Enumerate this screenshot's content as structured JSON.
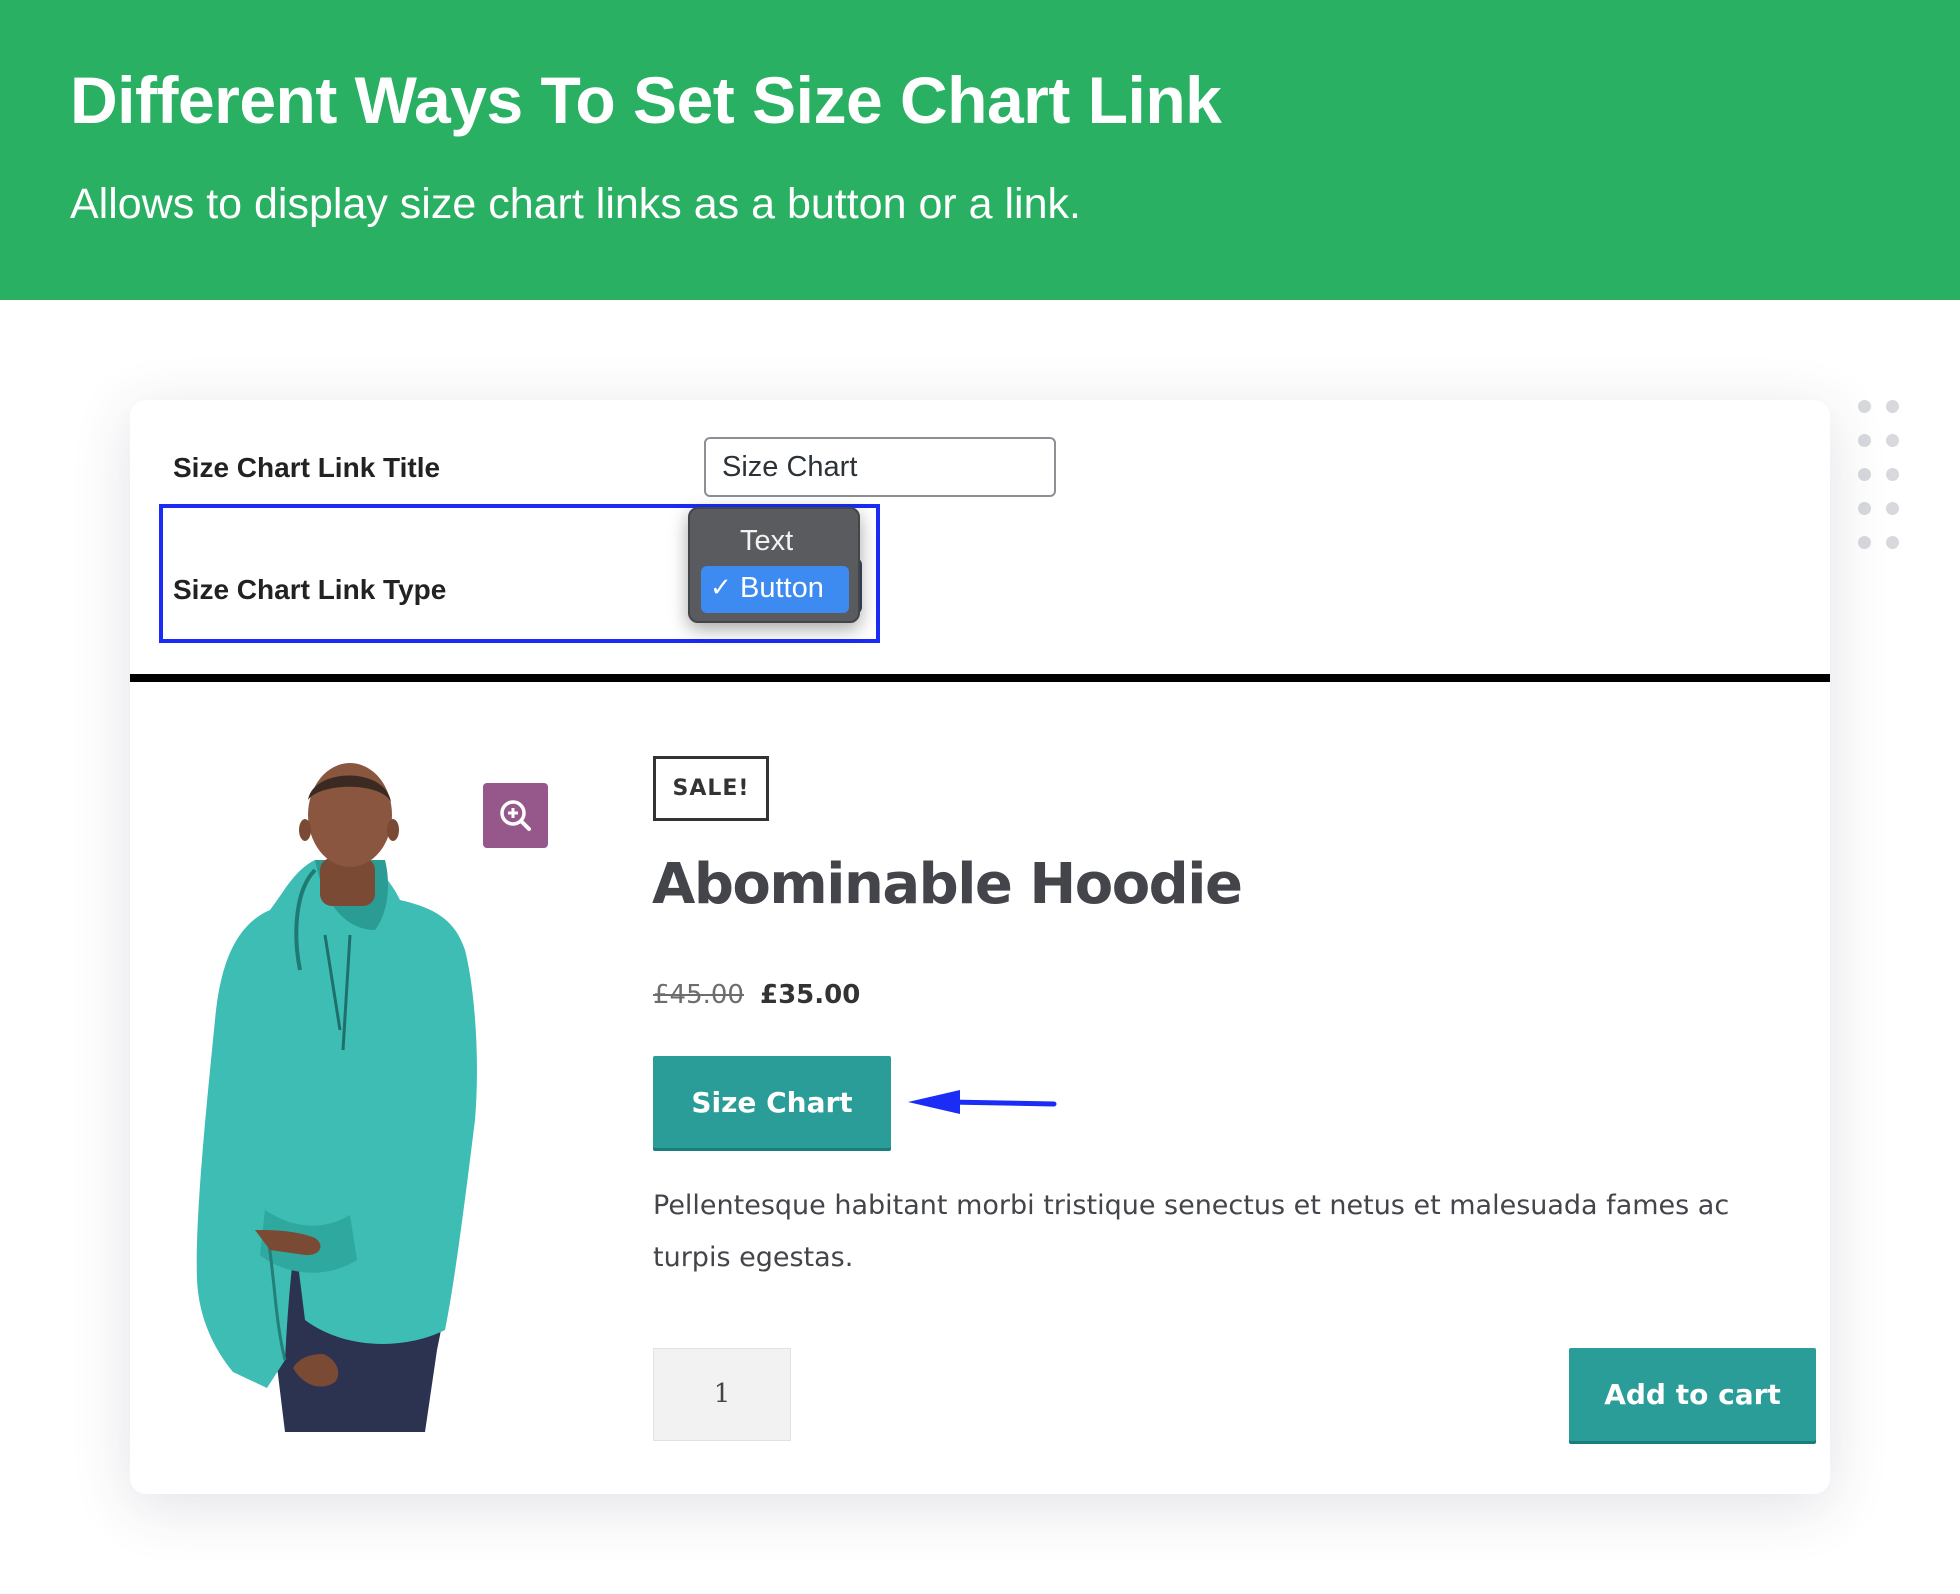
{
  "banner": {
    "title": "Different Ways To Set Size Chart Link",
    "subtitle": "Allows to display size chart links as a button or a link.",
    "color": "#2ab062"
  },
  "settings": {
    "title_label": "Size Chart Link Title",
    "title_value": "Size Chart",
    "type_label": "Size Chart Link Type",
    "type_options": [
      "Text",
      "Button"
    ],
    "type_selected": "Button",
    "check_glyph": "✓",
    "highlight_color": "#1a2cf5"
  },
  "product": {
    "badge": "SALE!",
    "name": "Abominable Hoodie",
    "price_old": "£45.00",
    "price_new": "£35.00",
    "size_chart_label": "Size Chart",
    "description": "Pellentesque habitant morbi tristique senectus et netus et malesuada fames ac turpis egestas.",
    "quantity": "1",
    "add_to_cart_label": "Add to cart",
    "button_color": "#2a9d99",
    "zoom_icon": "zoom-in-icon",
    "image_subject": "man-in-teal-hoodie"
  }
}
